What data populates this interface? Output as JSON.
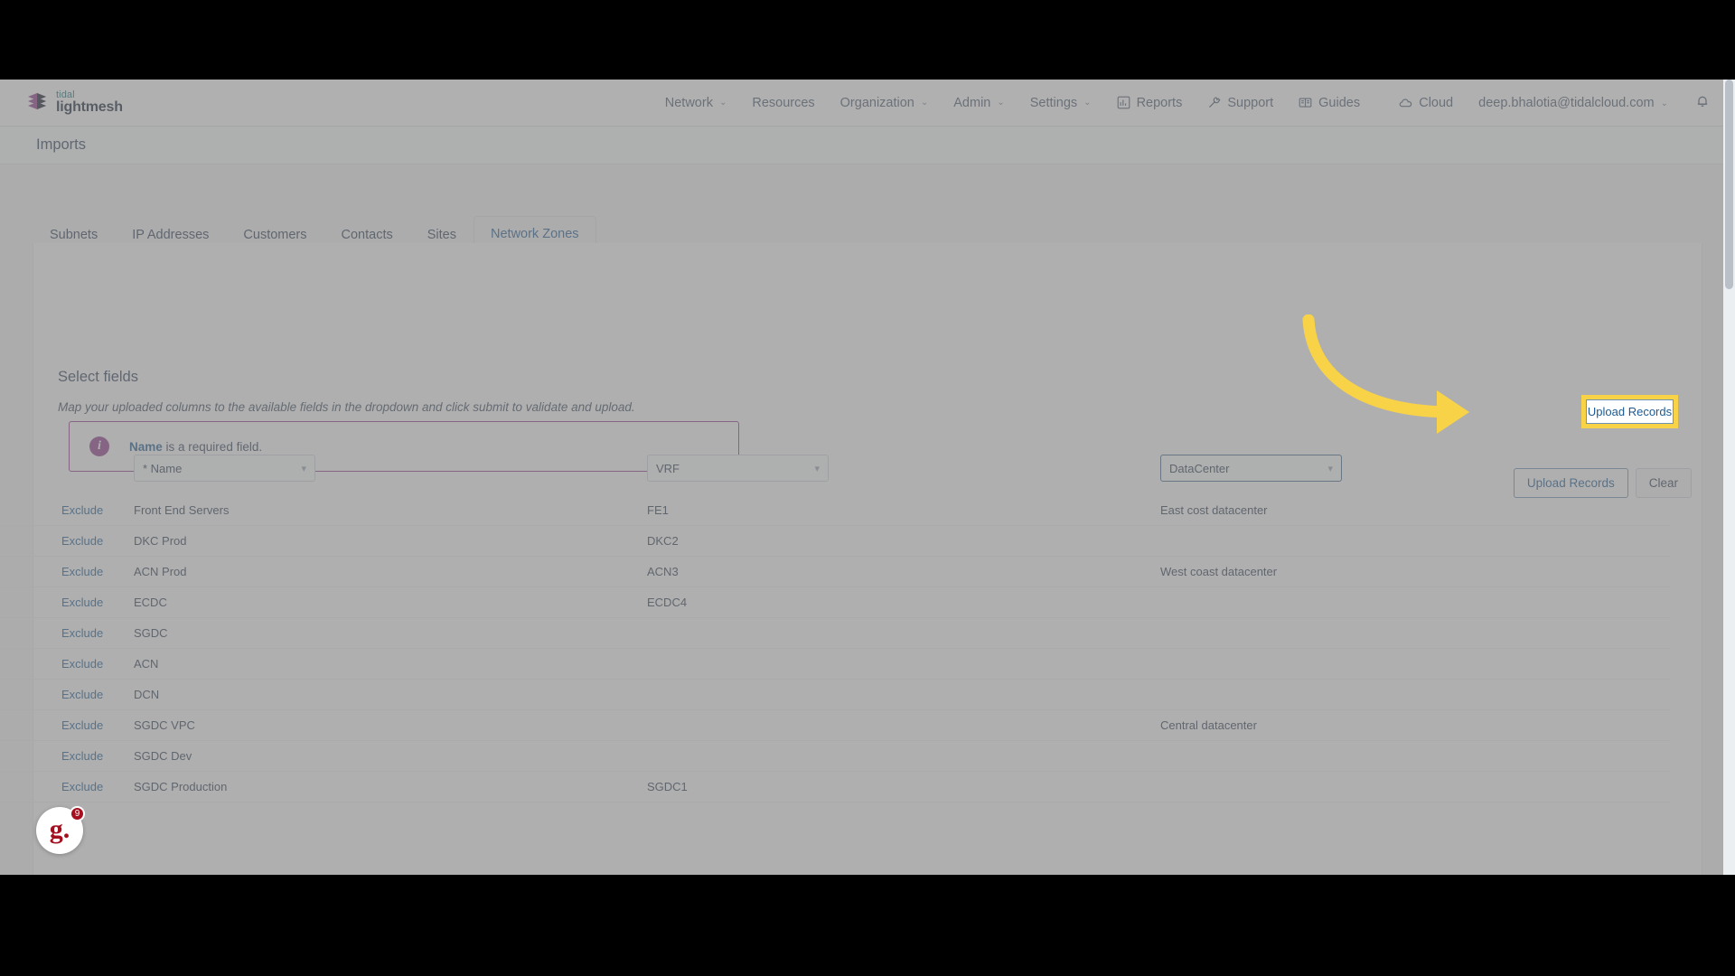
{
  "brand": {
    "top": "tidal",
    "bottom": "lightmesh"
  },
  "nav": {
    "items": [
      {
        "label": "Network",
        "chevron": "⌄",
        "icon": ""
      },
      {
        "label": "Resources",
        "chevron": "",
        "icon": ""
      },
      {
        "label": "Organization",
        "chevron": "⌄",
        "icon": ""
      },
      {
        "label": "Admin",
        "chevron": "⌄",
        "icon": ""
      },
      {
        "label": "Settings",
        "chevron": "⌄",
        "icon": ""
      },
      {
        "label": "Reports",
        "chevron": "",
        "icon": "bar-chart-icon"
      },
      {
        "label": "Support",
        "chevron": "",
        "icon": "wrench-icon"
      },
      {
        "label": "Guides",
        "chevron": "",
        "icon": "book-icon"
      }
    ],
    "cloud_label": "Cloud",
    "cloud_icon": "cloud-icon",
    "user_email": "deep.bhalotia@tidalcloud.com",
    "user_chevron": "⌄",
    "bell_icon": "notification-bell-icon"
  },
  "header": {
    "title": "Imports"
  },
  "tabs": [
    {
      "label": "Subnets",
      "active": false
    },
    {
      "label": "IP Addresses",
      "active": false
    },
    {
      "label": "Customers",
      "active": false
    },
    {
      "label": "Contacts",
      "active": false
    },
    {
      "label": "Sites",
      "active": false
    },
    {
      "label": "Network Zones",
      "active": true
    }
  ],
  "select_fields": {
    "title": "Select fields",
    "subtitle": "Map your uploaded columns to the available fields in the dropdown and click submit to validate and upload."
  },
  "alert": {
    "icon": "info-icon",
    "icon_glyph": "i",
    "bold": "Name",
    "text": " is a required field.",
    "border_color": "#8e3a8a",
    "icon_color": "#8e3a8a"
  },
  "actions": {
    "upload_label": "Upload Records",
    "clear_label": "Clear",
    "highlight_color": "#f8d347",
    "accent_color": "#1d5a91"
  },
  "mapping": {
    "exclude_label": "Exclude",
    "dropdowns": [
      {
        "value": "* Name",
        "focused": false
      },
      {
        "value": "VRF",
        "focused": false
      },
      {
        "value": "DataCenter",
        "focused": true
      }
    ],
    "rows": [
      {
        "name": "Front End Servers",
        "vrf": "FE1",
        "datacenter": "East cost datacenter"
      },
      {
        "name": "DKC Prod",
        "vrf": "DKC2",
        "datacenter": ""
      },
      {
        "name": "ACN Prod",
        "vrf": "ACN3",
        "datacenter": "West coast datacenter"
      },
      {
        "name": "ECDC",
        "vrf": "ECDC4",
        "datacenter": ""
      },
      {
        "name": "SGDC",
        "vrf": "",
        "datacenter": ""
      },
      {
        "name": "ACN",
        "vrf": "",
        "datacenter": ""
      },
      {
        "name": "DCN",
        "vrf": "",
        "datacenter": ""
      },
      {
        "name": "SGDC VPC",
        "vrf": "",
        "datacenter": "Central datacenter"
      },
      {
        "name": "SGDC Dev",
        "vrf": "",
        "datacenter": ""
      },
      {
        "name": "SGDC Production",
        "vrf": "SGDC1",
        "datacenter": ""
      }
    ]
  },
  "widget": {
    "letter": "g.",
    "badge": "9"
  }
}
